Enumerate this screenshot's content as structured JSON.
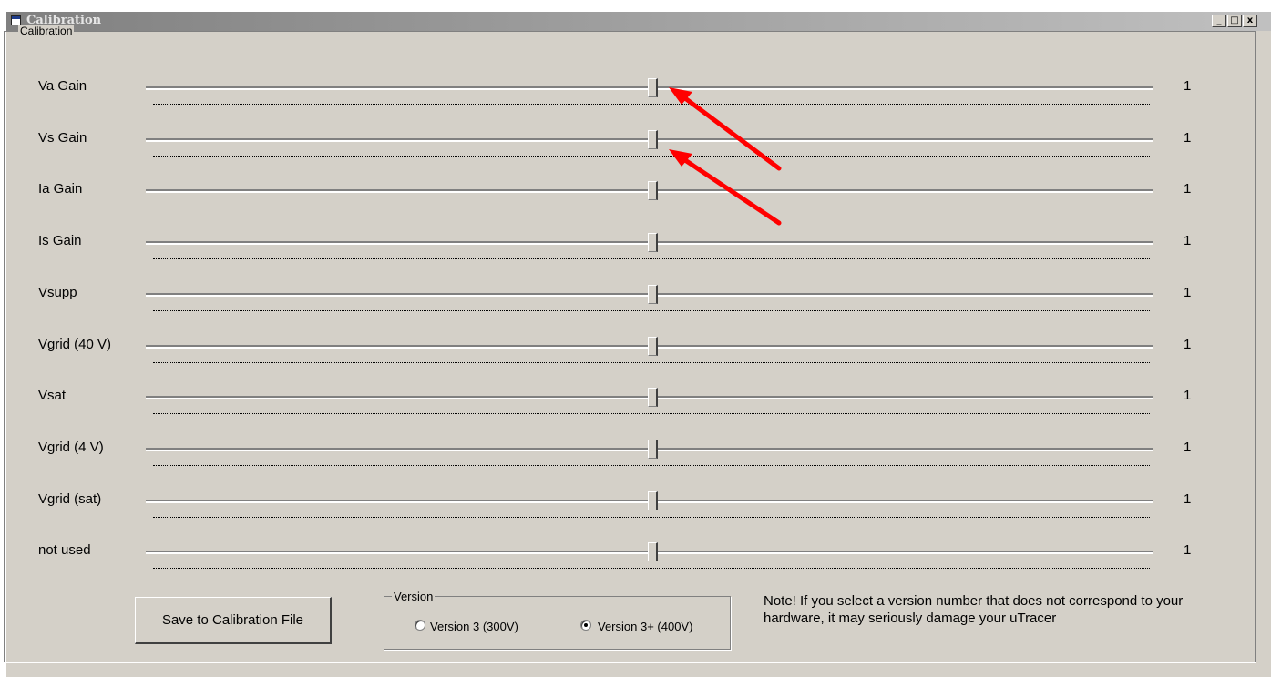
{
  "window": {
    "title": "Calibration",
    "minimize": "_",
    "maximize": "□",
    "close": "x"
  },
  "frame": {
    "legend": "Calibration"
  },
  "sliders": [
    {
      "label": "Va Gain",
      "value": "1",
      "position": 0.5
    },
    {
      "label": "Vs Gain",
      "value": "1",
      "position": 0.5
    },
    {
      "label": "Ia Gain",
      "value": "1",
      "position": 0.5
    },
    {
      "label": "Is Gain",
      "value": "1",
      "position": 0.5
    },
    {
      "label": "Vsupp",
      "value": "1",
      "position": 0.5
    },
    {
      "label": "Vgrid (40 V)",
      "value": "1",
      "position": 0.5
    },
    {
      "label": "Vsat",
      "value": "1",
      "position": 0.5
    },
    {
      "label": "Vgrid (4 V)",
      "value": "1",
      "position": 0.5
    },
    {
      "label": "Vgrid (sat)",
      "value": "1",
      "position": 0.5
    },
    {
      "label": "not used",
      "value": "1",
      "position": 0.5
    }
  ],
  "save_button": "Save to Calibration File",
  "version": {
    "legend": "Version",
    "options": [
      {
        "label": "Version 3 (300V)",
        "selected": false
      },
      {
        "label": "Version 3+ (400V)",
        "selected": true
      }
    ]
  },
  "note": "Note!  If you select a version number that does not correspond to your hardware, it may seriously damage your uTracer",
  "annotation_arrow_color": "#ff0000"
}
